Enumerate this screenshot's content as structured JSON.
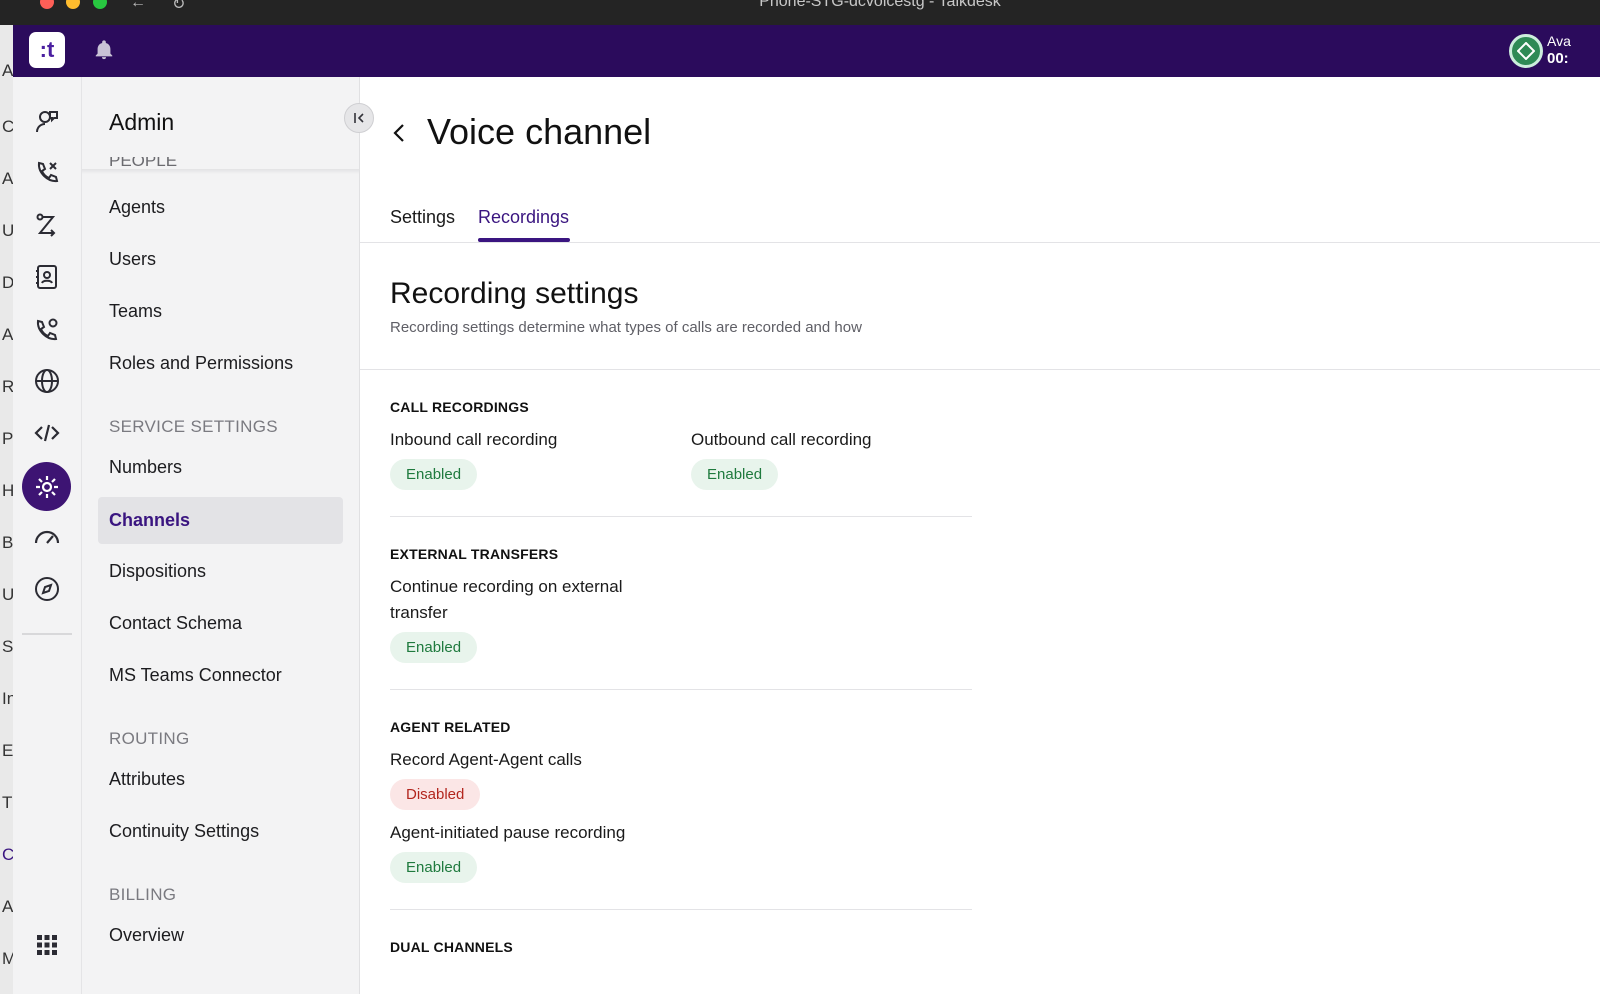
{
  "window": {
    "title": "Phone-STG-dcvoicestg - Talkdesk"
  },
  "background_window": {
    "letters": [
      "A",
      "C",
      "A",
      "U",
      "D",
      "A",
      "R",
      "P",
      "H",
      "B",
      "U",
      "S",
      "In",
      "E",
      "T",
      "C",
      "A",
      "M"
    ]
  },
  "appbar": {
    "logo_text": ":t",
    "status_label": "Ava",
    "status_timer": "00:"
  },
  "rail": {
    "icons": [
      "conversations-icon",
      "phone-calls-icon",
      "routing-icon",
      "contacts-icon",
      "phone-settings-icon",
      "globe-icon",
      "code-icon",
      "admin-gear-icon",
      "dashboard-icon",
      "compass-icon",
      "apps-grid-icon"
    ],
    "active_color": "#3d1473"
  },
  "subnav": {
    "title": "Admin",
    "people_cut_label": "PEOPLE",
    "items": [
      {
        "label": "Agents"
      },
      {
        "label": "Users"
      },
      {
        "label": "Teams"
      },
      {
        "label": "Roles and Permissions"
      },
      {
        "label": "Numbers"
      },
      {
        "label": "Channels",
        "active": true
      },
      {
        "label": "Dispositions"
      },
      {
        "label": "Contact Schema"
      },
      {
        "label": "MS Teams Connector"
      },
      {
        "label": "Attributes"
      },
      {
        "label": "Continuity Settings"
      },
      {
        "label": "Overview"
      }
    ],
    "sections": {
      "service": "SERVICE SETTINGS",
      "routing": "ROUTING",
      "billing": "BILLING"
    }
  },
  "main": {
    "title": "Voice channel",
    "tabs": [
      {
        "label": "Settings",
        "active": false
      },
      {
        "label": "Recordings",
        "active": true
      }
    ],
    "section_title": "Recording settings",
    "section_desc": "Recording settings determine what types of calls are recorded and how",
    "groups": {
      "call": {
        "heading": "CALL RECORDINGS",
        "inbound_label": "Inbound call recording",
        "inbound_status": "Enabled",
        "outbound_label": "Outbound call recording",
        "outbound_status": "Enabled"
      },
      "external": {
        "heading": "EXTERNAL TRANSFERS",
        "continue_label_1": "Continue recording on external",
        "continue_label_2": "transfer",
        "continue_status": "Enabled"
      },
      "agent": {
        "heading": "AGENT RELATED",
        "agent_agent_label": "Record Agent-Agent calls",
        "agent_agent_status": "Disabled",
        "pause_label": "Agent-initiated pause recording",
        "pause_status": "Enabled"
      },
      "dual": {
        "heading": "DUAL CHANNELS"
      }
    }
  },
  "colors": {
    "brand_purple": "#2b0b5c",
    "accent": "#3a1580",
    "enabled_bg": "#e8f4ec",
    "enabled_text": "#1f7a3e",
    "disabled_bg": "#fbe6e6",
    "disabled_text": "#b3261e"
  }
}
